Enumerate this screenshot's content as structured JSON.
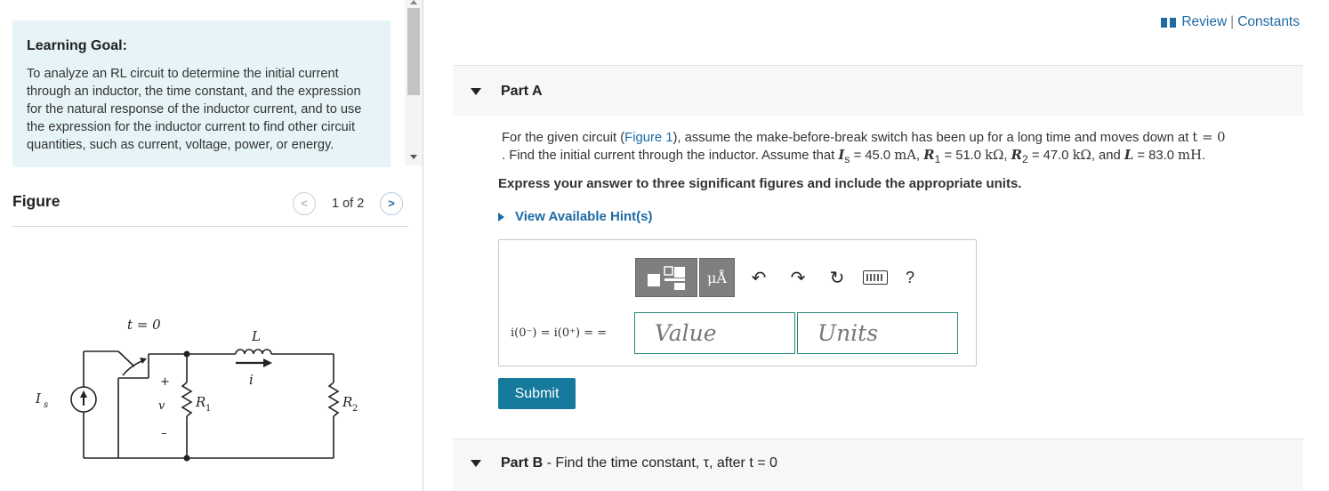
{
  "learning_goal": {
    "title": "Learning Goal:",
    "text": "To analyze an RL circuit to determine the initial current through an inductor, the time constant, and the expression for the natural response of the inductor current, and to use the expression for the inductor current to find other circuit quantities, such as current, voltage, power, or energy."
  },
  "figure": {
    "title": "Figure",
    "pager_text": "1 of 2",
    "labels": {
      "switch": "t = 0",
      "inductor": "L",
      "current": "i",
      "source": "I",
      "source_sub": "s",
      "voltage": "v",
      "plus": "+",
      "minus": "–",
      "r1": "R",
      "r1_sub": "1",
      "r2": "R",
      "r2_sub": "2"
    }
  },
  "header": {
    "review": "Review",
    "separator": "|",
    "constants": "Constants"
  },
  "part_a": {
    "label": "Part A",
    "question_pre": "For the given circuit (",
    "figure_link": "Figure 1",
    "question_mid": "), assume the make-before-break switch has been up for a long time and moves down at ",
    "t_eq": "t = 0",
    "question_line2_pre": ". Find the initial current through the inductor. Assume that ",
    "Is": "I",
    "Is_sub": "s",
    "Is_val": " = 45.0 ",
    "Is_unit": "mA",
    "R1": "R",
    "R1_sub": "1",
    "R1_val": " = 51.0 ",
    "R1_unit": "kΩ",
    "R2": "R",
    "R2_sub": "2",
    "R2_val": " = 47.0 ",
    "R2_unit": "kΩ",
    "and_L": ", and ",
    "L": "L",
    "L_val": " = 83.0 ",
    "L_unit": "mH",
    "express": "Express your answer to three significant figures and include the appropriate units.",
    "hints": "View Available Hint(s)",
    "toolbar": {
      "units_btn": "μÅ",
      "undo": "↶",
      "redo": "↷",
      "reset": "↻",
      "keyboard": "keyboard",
      "help": "?"
    },
    "eq_label": "i(0⁻) = i(0⁺) = =",
    "value_placeholder": "Value",
    "units_placeholder": "Units",
    "submit": "Submit"
  },
  "part_b": {
    "label": "Part B",
    "dash": " - ",
    "text": "Find the time constant, τ, after t = 0"
  }
}
